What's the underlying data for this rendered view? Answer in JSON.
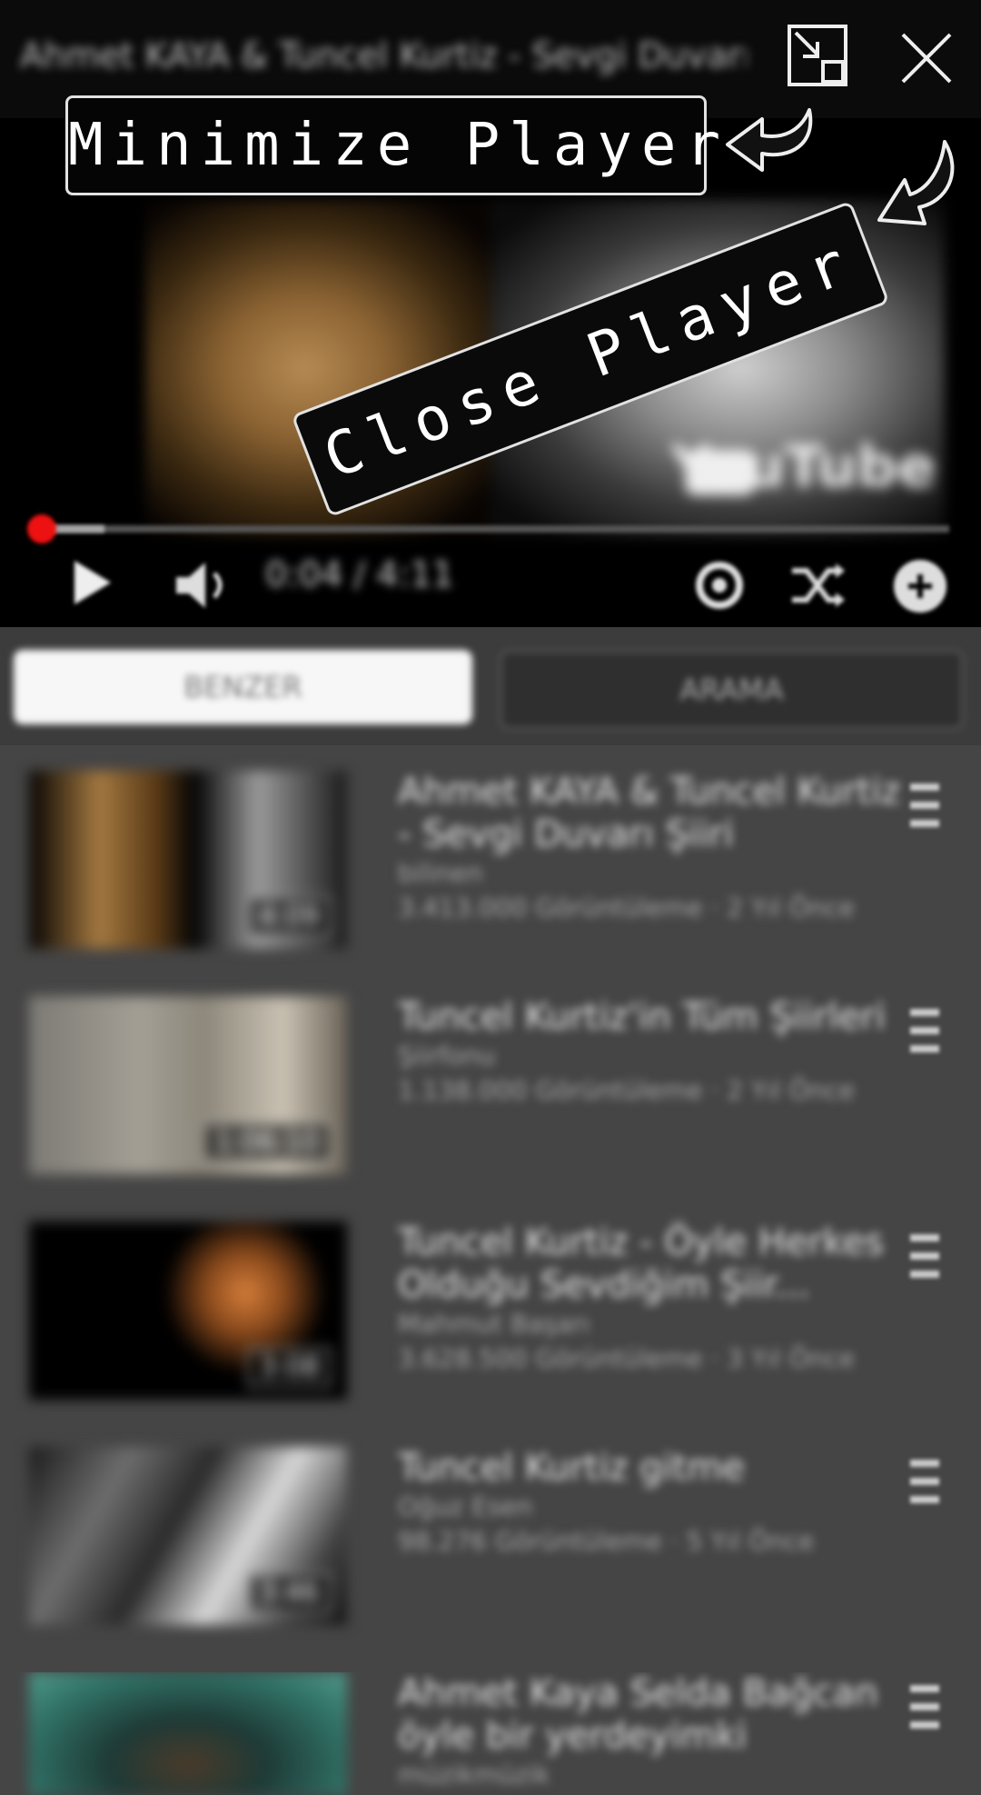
{
  "header": {
    "video_title": "Ahmet KAYA & Tuncel Kurtiz - Sevgi Duvarı Şiiri",
    "minimize_icon": "minimize-icon",
    "close_icon": "close-icon"
  },
  "overlay": {
    "minimize_label": "Minimize Player",
    "close_label": "Close Player"
  },
  "player": {
    "watermark": "YouTube",
    "time": "0:04 / 4:11",
    "progress": 0.016,
    "icons": [
      "play-icon",
      "volume-icon",
      "settings-icon",
      "shuffle-icon",
      "more-icon"
    ]
  },
  "tabs": [
    {
      "label": "BENZER",
      "active": true
    },
    {
      "label": "ARAMA",
      "active": false
    }
  ],
  "videos": [
    {
      "title": "Ahmet KAYA & Tuncel Kurtiz - Sevgi Duvarı Şiiri",
      "channel": "bilinen",
      "meta": "3.413.000 Görüntüleme · 2 Yıl Önce",
      "duration": "4:09"
    },
    {
      "title": "Tuncel Kurtiz'in Tüm Şiirleri",
      "channel": "Şiirfonu",
      "meta": "1.138.000 Görüntüleme · 2 Yıl Önce",
      "duration": "1:06:10"
    },
    {
      "title": "Tuncel Kurtiz - Öyle Herkes Olduğu Sevdiğim Şiir...",
      "channel": "Mahmut Başarı",
      "meta": "3.628.500 Görüntüleme · 3 Yıl Önce",
      "duration": "3:08"
    },
    {
      "title": "Tuncel Kurtiz gitme",
      "channel": "Oğuz Esen",
      "meta": "98.276 Görüntüleme · 5 Yıl Önce",
      "duration": "3:46"
    },
    {
      "title": "Ahmet Kaya Selda Bağcan öyle bir yerdeyimki Kırlarda...",
      "channel": "müzikmüzik",
      "meta": "",
      "duration": ""
    }
  ],
  "colors": {
    "progress_played": "#ee1111",
    "list_background": "#454545",
    "player_background": "#000000"
  }
}
